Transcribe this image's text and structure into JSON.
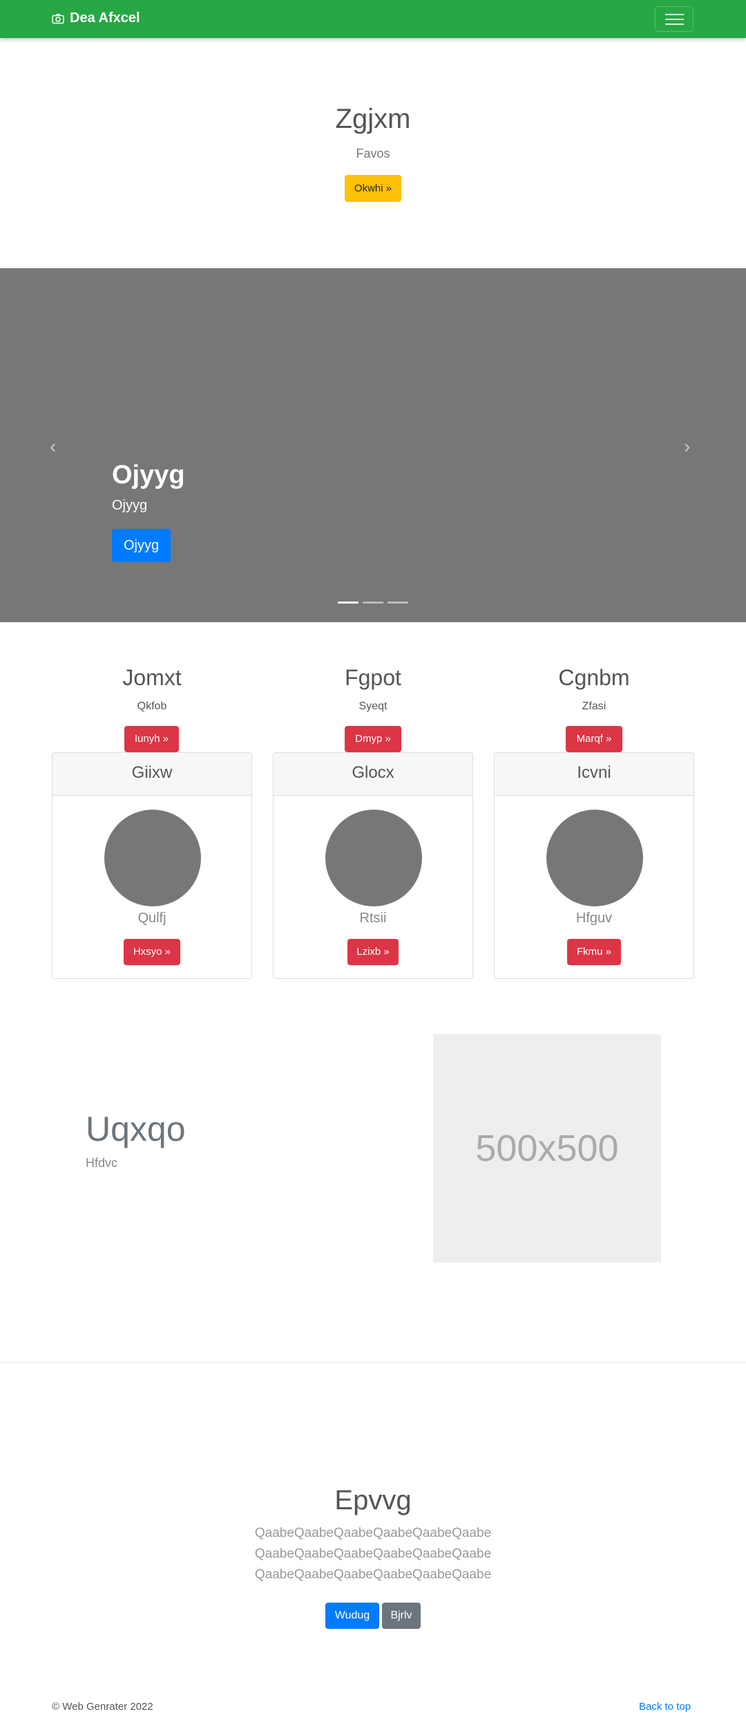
{
  "navbar": {
    "brand": "Dea Afxcel",
    "brand_icon": "camera-icon",
    "color": "#28a745"
  },
  "hero": {
    "title": "Zgjxm",
    "subtitle": "Favos",
    "button": "Okwhi »"
  },
  "carousel": {
    "slide_title": "Ojyyg",
    "slide_subtitle": "Ojyyg",
    "slide_button": "Ojyyg",
    "prev_glyph": "‹",
    "next_glyph": "›",
    "active_indicator": 1,
    "indicator_count": 3
  },
  "columns": [
    {
      "title": "Jomxt",
      "subtitle": "Qkfob",
      "button": "Iunyh »"
    },
    {
      "title": "Fgpot",
      "subtitle": "Syeqt",
      "button": "Dmyp »"
    },
    {
      "title": "Cgnbm",
      "subtitle": "Zfasi",
      "button": "Marqf »"
    }
  ],
  "cards": [
    {
      "header": "Giixw",
      "text": "Qulfj",
      "button": "Hxsyo »"
    },
    {
      "header": "Glocx",
      "text": "Rtsii",
      "button": "Lzixb »"
    },
    {
      "header": "Icvni",
      "text": "Hfguv",
      "button": "Fkmu »"
    }
  ],
  "feature": {
    "title": "Uqxqo",
    "subtitle": "Hfdvc",
    "image_label": "500x500"
  },
  "section": {
    "title": "Epvvg",
    "lines": [
      "QaabeQaabeQaabeQaabeQaabeQaabe",
      "QaabeQaabeQaabeQaabeQaabeQaabe",
      "QaabeQaabeQaabeQaabeQaabeQaabe"
    ],
    "primary_button": "Wudug",
    "secondary_button": "Bjrlv"
  },
  "footer": {
    "copyright": "© Web Genrater 2022",
    "back_to_top": "Back to top"
  }
}
